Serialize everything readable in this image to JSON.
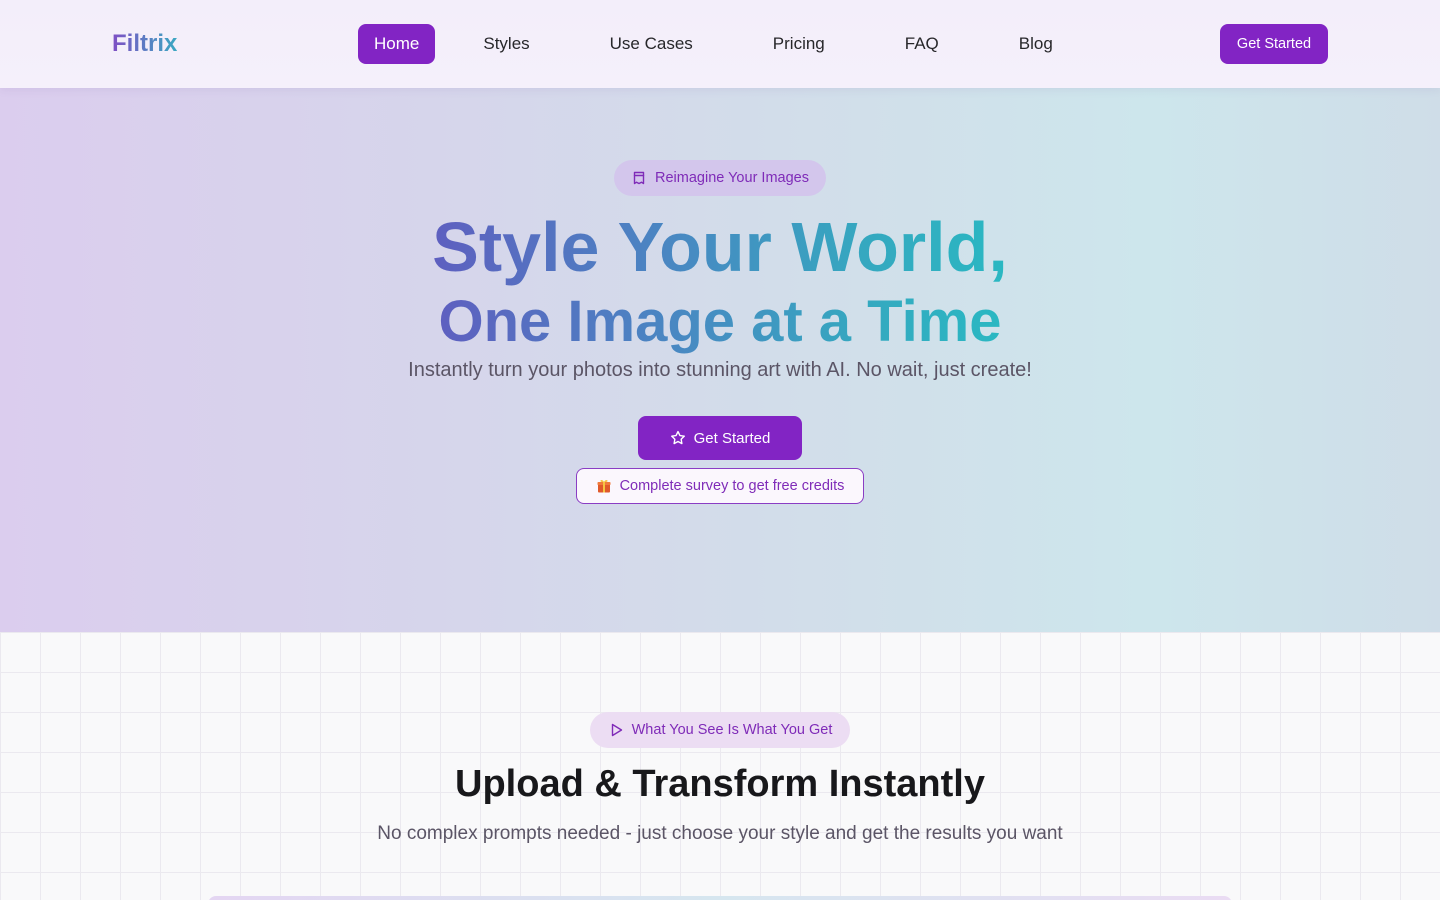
{
  "header": {
    "logo": "Filtrix",
    "nav": [
      {
        "label": "Home",
        "active": true
      },
      {
        "label": "Styles"
      },
      {
        "label": "Use Cases"
      },
      {
        "label": "Pricing"
      },
      {
        "label": "FAQ"
      },
      {
        "label": "Blog"
      }
    ],
    "cta_label": "Get Started"
  },
  "hero": {
    "badge": {
      "icon": "ticket-icon",
      "label": "Reimagine Your Images"
    },
    "title_line1": "Style Your World,",
    "title_line2": "One Image at a Time",
    "subtitle": "Instantly turn your photos into stunning art with AI. No wait, just create!",
    "cta": {
      "icon": "star-icon",
      "label": "Get Started"
    },
    "survey": {
      "icon": "gift-icon",
      "label": "Complete survey to get free credits"
    }
  },
  "section2": {
    "badge": {
      "icon": "play-icon",
      "label": "What You See Is What You Get"
    },
    "title": "Upload & Transform Instantly",
    "subtitle": "No complex prompts needed - just choose your style and get the results you want"
  },
  "colors": {
    "accent": "#8224c4",
    "accent_text": "#7f2bb8",
    "gradient_start": "#5e5fc0",
    "gradient_end": "#2ab8c2"
  }
}
